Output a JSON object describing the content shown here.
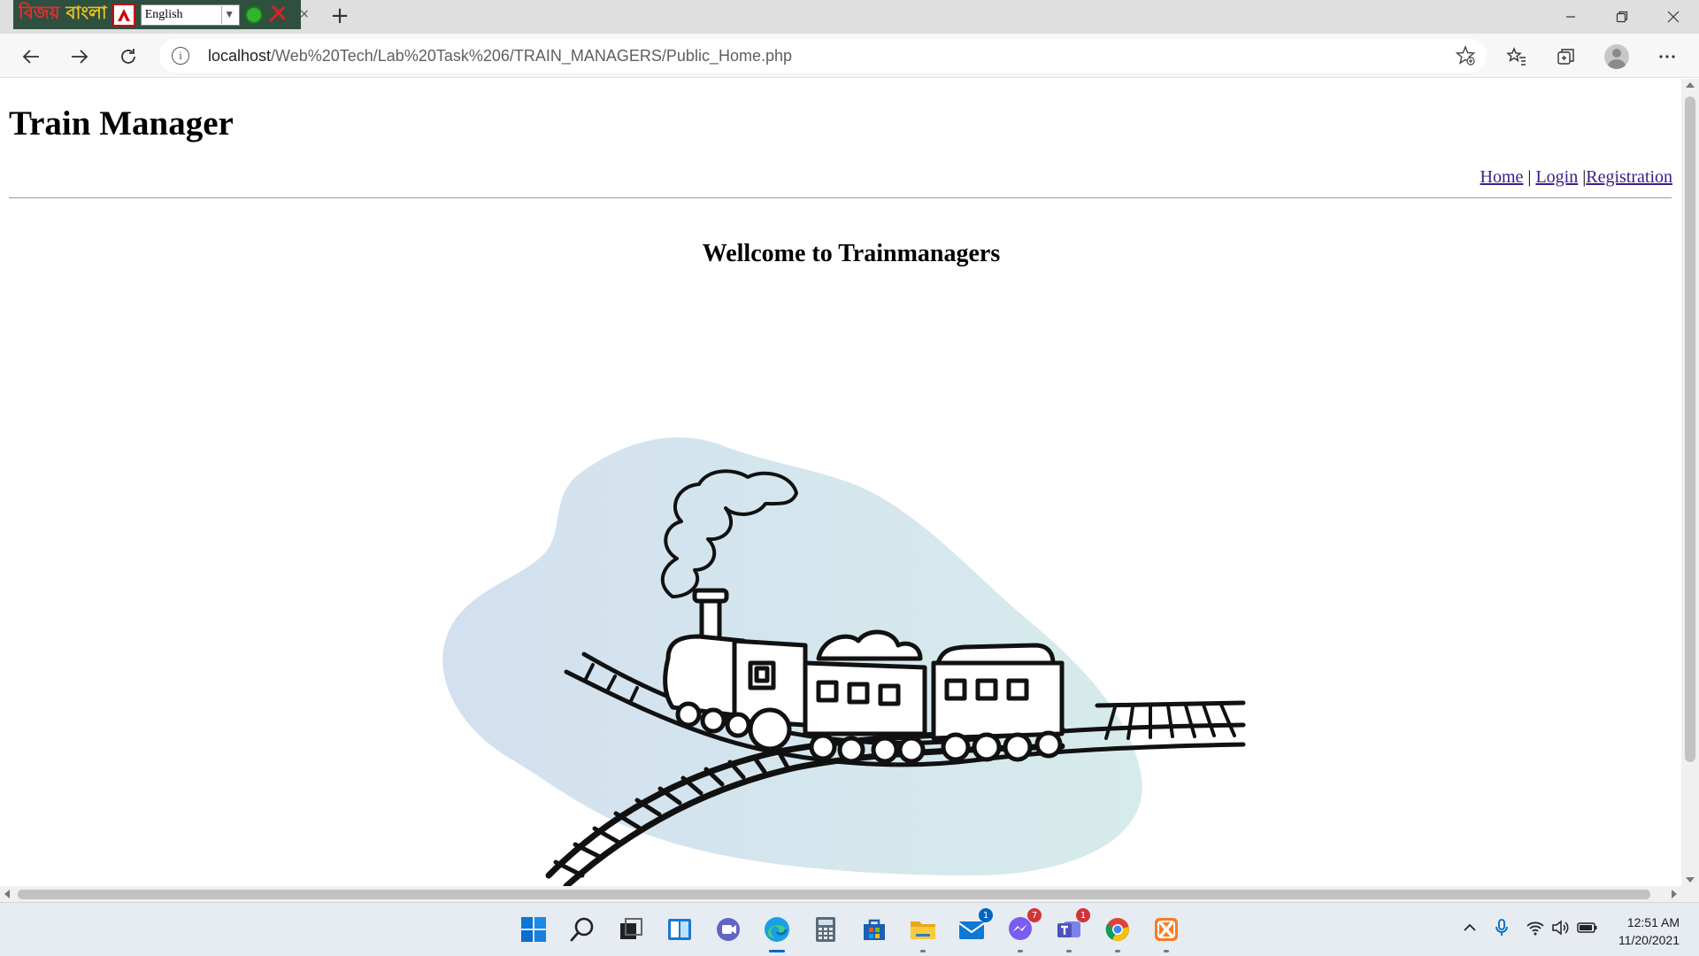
{
  "browser": {
    "extension_bar": {
      "bijoy_logo_part1": "বিজয়",
      "bijoy_logo_part2": " বাংলা",
      "language_selected": "English"
    },
    "tab_close": "×",
    "new_tab": "+",
    "window_controls": {
      "minimize": "—",
      "restore": "❐",
      "close": "✕"
    },
    "address": {
      "info_icon": "i",
      "host": "localhost",
      "path": "/Web%20Tech/Lab%20Task%206/TRAIN_MANAGERS/Public_Home.php"
    }
  },
  "page": {
    "site_title": "Train Manager",
    "nav": {
      "home": "Home",
      "sep1": " | ",
      "login": "Login",
      "sep2": " |",
      "registration": "Registration"
    },
    "welcome_heading": "Wellcome to Trainmanagers",
    "illustration": "train-on-tracks-sketch"
  },
  "taskbar": {
    "apps": [
      {
        "name": "start-icon"
      },
      {
        "name": "search-icon"
      },
      {
        "name": "task-view-icon"
      },
      {
        "name": "widgets-icon"
      },
      {
        "name": "teams-chat-icon"
      },
      {
        "name": "edge-icon",
        "active": true
      },
      {
        "name": "calculator-icon"
      },
      {
        "name": "store-icon"
      },
      {
        "name": "file-explorer-icon"
      },
      {
        "name": "mail-icon",
        "badge": "1"
      },
      {
        "name": "messenger-icon",
        "badge": "7"
      },
      {
        "name": "teams-icon",
        "badge": "1"
      },
      {
        "name": "chrome-icon"
      },
      {
        "name": "xampp-icon"
      }
    ],
    "badges": {
      "mail": "1",
      "messenger": "7",
      "teams": "1"
    },
    "clock": {
      "time": "12:51 AM",
      "date": "11/20/2021"
    }
  },
  "colors": {
    "link": "#3b1c8c",
    "blob": "#d6e6ef",
    "taskbar": "#e6ecf1",
    "edge_accent": "#0067c0"
  }
}
